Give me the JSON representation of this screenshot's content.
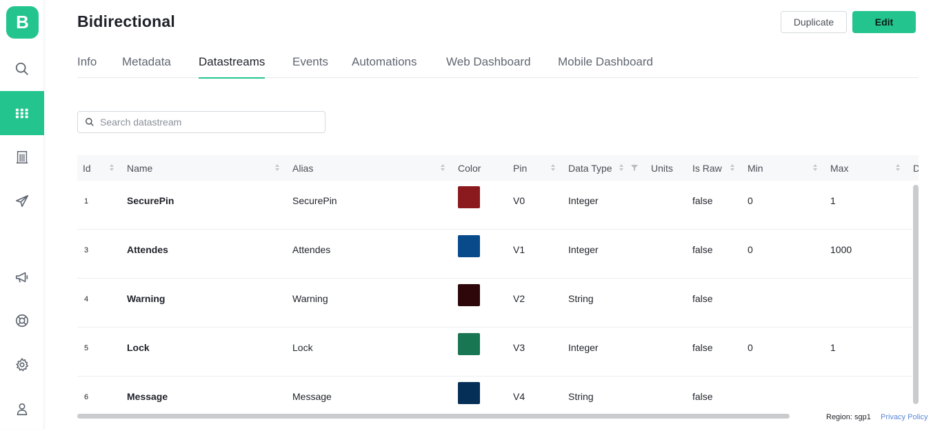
{
  "app": {
    "logo_letter": "B",
    "accent": "#23c48e"
  },
  "sidebar": {
    "items": [
      {
        "icon": "search-icon"
      },
      {
        "icon": "grid-icon",
        "active": true
      },
      {
        "icon": "building-icon"
      },
      {
        "icon": "send-icon"
      },
      {
        "icon": "megaphone-icon"
      },
      {
        "icon": "lifebuoy-icon"
      },
      {
        "icon": "gear-icon"
      },
      {
        "icon": "user-badge-icon"
      }
    ]
  },
  "header": {
    "title": "Bidirectional",
    "duplicate_label": "Duplicate",
    "edit_label": "Edit"
  },
  "tabs": [
    {
      "label": "Info"
    },
    {
      "label": "Metadata"
    },
    {
      "label": "Datastreams",
      "active": true
    },
    {
      "label": "Events"
    },
    {
      "label": "Automations"
    },
    {
      "label": "Web Dashboard"
    },
    {
      "label": "Mobile Dashboard"
    }
  ],
  "search": {
    "placeholder": "Search datastream",
    "value": ""
  },
  "table": {
    "columns": [
      "Id",
      "Name",
      "Alias",
      "Color",
      "Pin",
      "Data Type",
      "Units",
      "Is Raw",
      "Min",
      "Max",
      "D"
    ],
    "rows": [
      {
        "id": "1",
        "name": "SecurePin",
        "alias": "SecurePin",
        "color": "#8b1a1e",
        "pin": "V0",
        "data_type": "Integer",
        "units": "",
        "is_raw": "false",
        "min": "0",
        "max": "1"
      },
      {
        "id": "3",
        "name": "Attendes",
        "alias": "Attendes",
        "color": "#084a8a",
        "pin": "V1",
        "data_type": "Integer",
        "units": "",
        "is_raw": "false",
        "min": "0",
        "max": "1000"
      },
      {
        "id": "4",
        "name": "Warning",
        "alias": "Warning",
        "color": "#2e070b",
        "pin": "V2",
        "data_type": "String",
        "units": "",
        "is_raw": "false",
        "min": "",
        "max": ""
      },
      {
        "id": "5",
        "name": "Lock",
        "alias": "Lock",
        "color": "#187652",
        "pin": "V3",
        "data_type": "Integer",
        "units": "",
        "is_raw": "false",
        "min": "0",
        "max": "1"
      },
      {
        "id": "6",
        "name": "Message",
        "alias": "Message",
        "color": "#052f57",
        "pin": "V4",
        "data_type": "String",
        "units": "",
        "is_raw": "false",
        "min": "",
        "max": ""
      }
    ]
  },
  "footer": {
    "region": "Region: sgp1",
    "privacy": "Privacy Policy"
  }
}
